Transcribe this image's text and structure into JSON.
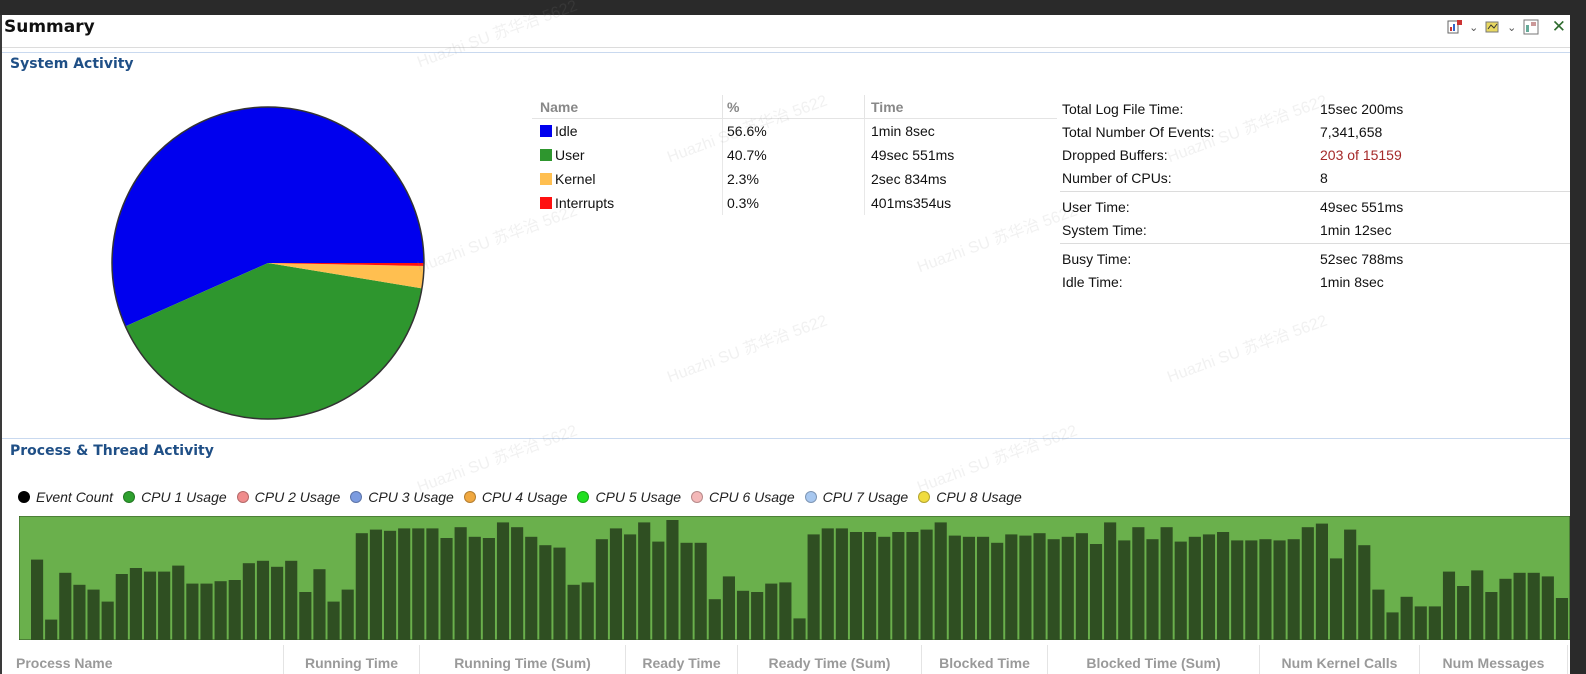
{
  "window": {
    "title": "Summary"
  },
  "toolbar": {
    "icons": [
      "chart-export-icon",
      "chart-options-icon",
      "layout-icon"
    ],
    "close_glyph": "✕"
  },
  "system_activity": {
    "section_title": "System Activity",
    "table_headers": {
      "name": "Name",
      "pct": "%",
      "time": "Time"
    },
    "rows": [
      {
        "name": "Idle",
        "pct": "56.6%",
        "time": "1min 8sec",
        "color": "#0000ee"
      },
      {
        "name": "User",
        "pct": "40.7%",
        "time": "49sec 551ms",
        "color": "#2e962e"
      },
      {
        "name": "Kernel",
        "pct": "2.3%",
        "time": "2sec 834ms",
        "color": "#ffbf50"
      },
      {
        "name": "Interrupts",
        "pct": "0.3%",
        "time": "401ms354us",
        "color": "#ff1010"
      }
    ],
    "stats_group1": [
      {
        "label": "Total Log File Time:",
        "value": "15sec 200ms"
      },
      {
        "label": "Total Number Of Events:",
        "value": "7,341,658"
      },
      {
        "label": "Dropped Buffers:",
        "value": "203 of 15159",
        "alert": true
      },
      {
        "label": "Number of CPUs:",
        "value": "8"
      }
    ],
    "stats_group2": [
      {
        "label": "User Time:",
        "value": "49sec 551ms"
      },
      {
        "label": "System Time:",
        "value": "1min 12sec"
      }
    ],
    "stats_group3": [
      {
        "label": "Busy Time:",
        "value": "52sec 788ms"
      },
      {
        "label": "Idle Time:",
        "value": "1min 8sec"
      }
    ]
  },
  "process_activity": {
    "section_title": "Process & Thread Activity",
    "series_legend": [
      {
        "name": "Event Count",
        "color": "#000000"
      },
      {
        "name": "CPU 1 Usage",
        "color": "#2ea02e"
      },
      {
        "name": "CPU 2 Usage",
        "color": "#f08c8c"
      },
      {
        "name": "CPU 3 Usage",
        "color": "#7b9be0"
      },
      {
        "name": "CPU 4 Usage",
        "color": "#f0a840"
      },
      {
        "name": "CPU 5 Usage",
        "color": "#20e020"
      },
      {
        "name": "CPU 6 Usage",
        "color": "#f4b8b8"
      },
      {
        "name": "CPU 7 Usage",
        "color": "#a8c8f0"
      },
      {
        "name": "CPU 8 Usage",
        "color": "#f0dc40"
      }
    ],
    "grid_headers": [
      "Process Name",
      "Running Time",
      "Running Time (Sum)",
      "Ready Time",
      "Ready Time (Sum)",
      "Blocked Time",
      "Blocked Time (Sum)",
      "Num Kernel Calls",
      "Num Messages"
    ]
  },
  "chart_data": [
    {
      "type": "pie",
      "categories": [
        "Idle",
        "User",
        "Kernel",
        "Interrupts"
      ],
      "values": [
        56.6,
        40.7,
        2.3,
        0.3
      ],
      "colors": [
        "#0000ee",
        "#2e962e",
        "#ffbf50",
        "#ff1010"
      ]
    },
    {
      "type": "bar",
      "bar_color": "#2f4f22",
      "background_color": "#6ab04c",
      "values": [
        0.67,
        0.17,
        0.56,
        0.46,
        0.42,
        0.32,
        0.55,
        0.6,
        0.57,
        0.57,
        0.62,
        0.47,
        0.47,
        0.49,
        0.5,
        0.64,
        0.66,
        0.61,
        0.66,
        0.4,
        0.59,
        0.32,
        0.42,
        0.89,
        0.92,
        0.91,
        0.93,
        0.93,
        0.93,
        0.85,
        0.94,
        0.86,
        0.85,
        0.98,
        0.94,
        0.86,
        0.79,
        0.77,
        0.46,
        0.48,
        0.84,
        0.93,
        0.88,
        0.98,
        0.82,
        1.0,
        0.81,
        0.81,
        0.34,
        0.53,
        0.41,
        0.4,
        0.47,
        0.48,
        0.18,
        0.88,
        0.93,
        0.93,
        0.9,
        0.9,
        0.86,
        0.9,
        0.9,
        0.92,
        0.98,
        0.87,
        0.86,
        0.86,
        0.81,
        0.88,
        0.87,
        0.89,
        0.84,
        0.86,
        0.89,
        0.8,
        0.98,
        0.83,
        0.94,
        0.84,
        0.94,
        0.82,
        0.86,
        0.88,
        0.9,
        0.83,
        0.83,
        0.84,
        0.83,
        0.84,
        0.94,
        0.97,
        0.68,
        0.92,
        0.79,
        0.42,
        0.23,
        0.36,
        0.28,
        0.28,
        0.57,
        0.45,
        0.58,
        0.4,
        0.51,
        0.56,
        0.56,
        0.53,
        0.35
      ]
    }
  ]
}
